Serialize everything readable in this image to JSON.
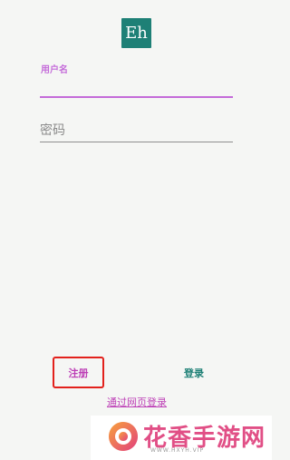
{
  "app": {
    "logo_text": "Eh",
    "logo_color": "#1e8076",
    "accent_color": "#c46bd9"
  },
  "login_form": {
    "username_label": "用户名",
    "username_value": "",
    "password_placeholder": "密码",
    "password_value": ""
  },
  "actions": {
    "register_label": "注册",
    "login_label": "登录",
    "web_login_link": "通过网页登录",
    "highlight_color": "#e2211c"
  },
  "watermark": {
    "title": "花香手游网",
    "subtitle": "WWW.HXYH.VIP"
  }
}
